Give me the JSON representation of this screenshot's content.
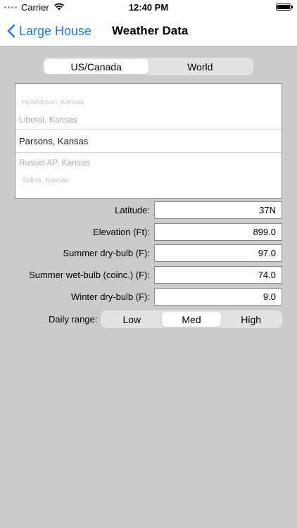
{
  "status_bar": {
    "carrier": "Carrier",
    "time": "12:40 PM"
  },
  "nav": {
    "back_label": "Large House",
    "title": "Weather Data"
  },
  "region_tabs": [
    {
      "label": "US/Canada",
      "selected": true
    },
    {
      "label": "World",
      "selected": false
    }
  ],
  "picker": {
    "rows": [
      "Hutchinson, Kansas",
      "Liberal, Kansas",
      "Parsons, Kansas",
      "Russel AP, Kansas",
      "Salina, Kansas"
    ],
    "selected": "Parsons, Kansas"
  },
  "fields": {
    "latitude": {
      "label": "Latitude:",
      "value": "37N"
    },
    "elevation": {
      "label": "Elevation (Ft):",
      "value": "899.0"
    },
    "summer_dry": {
      "label": "Summer dry-bulb (F):",
      "value": "97.0"
    },
    "summer_wet": {
      "label": "Summer wet-bulb (coinc.) (F):",
      "value": "74.0"
    },
    "winter_dry": {
      "label": "Winter dry-bulb (F):",
      "value": "9.0"
    }
  },
  "daily_range": {
    "label": "Daily range:",
    "options": [
      "Low",
      "Med",
      "High"
    ],
    "selected": "Med"
  },
  "colors": {
    "accent": "#1a7cf5",
    "background": "#cbcbcb"
  }
}
